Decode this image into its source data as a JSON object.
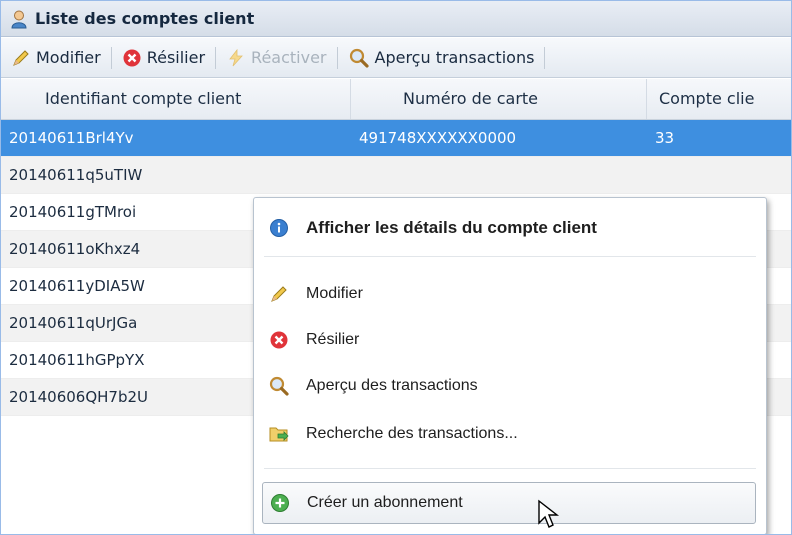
{
  "panel": {
    "title": "Liste des comptes client"
  },
  "toolbar": {
    "modify": "Modifier",
    "cancel": "Résilier",
    "reactivate": "Réactiver",
    "preview": "Aperçu transactions"
  },
  "grid": {
    "columns": [
      "Identifiant compte client",
      "Numéro de carte",
      "Compte clie"
    ],
    "rows": [
      {
        "id": "20140611Brl4Yv",
        "card": "491748XXXXXX0000",
        "account": "33"
      },
      {
        "id": "20140611q5uTIW",
        "card": "",
        "account": ""
      },
      {
        "id": "20140611gTMroi",
        "card": "",
        "account": ""
      },
      {
        "id": "20140611oKhxz4",
        "card": "",
        "account": ""
      },
      {
        "id": "20140611yDIA5W",
        "card": "",
        "account": ""
      },
      {
        "id": "20140611qUrJGa",
        "card": "",
        "account": ""
      },
      {
        "id": "20140611hGPpYX",
        "card": "",
        "account": ""
      },
      {
        "id": "20140606QH7b2U",
        "card": "",
        "account": ""
      }
    ]
  },
  "context_menu": {
    "details": "Afficher les détails du compte client",
    "modify": "Modifier",
    "cancel": "Résilier",
    "preview": "Aperçu des transactions",
    "search": "Recherche des transactions...",
    "subscribe": "Créer un abonnement"
  },
  "colors": {
    "selection": "#3e8fe0",
    "header_bg": "#dfe6ef",
    "delete_red": "#e0343a",
    "info_blue": "#3a7fd0",
    "add_green": "#4caf50"
  }
}
